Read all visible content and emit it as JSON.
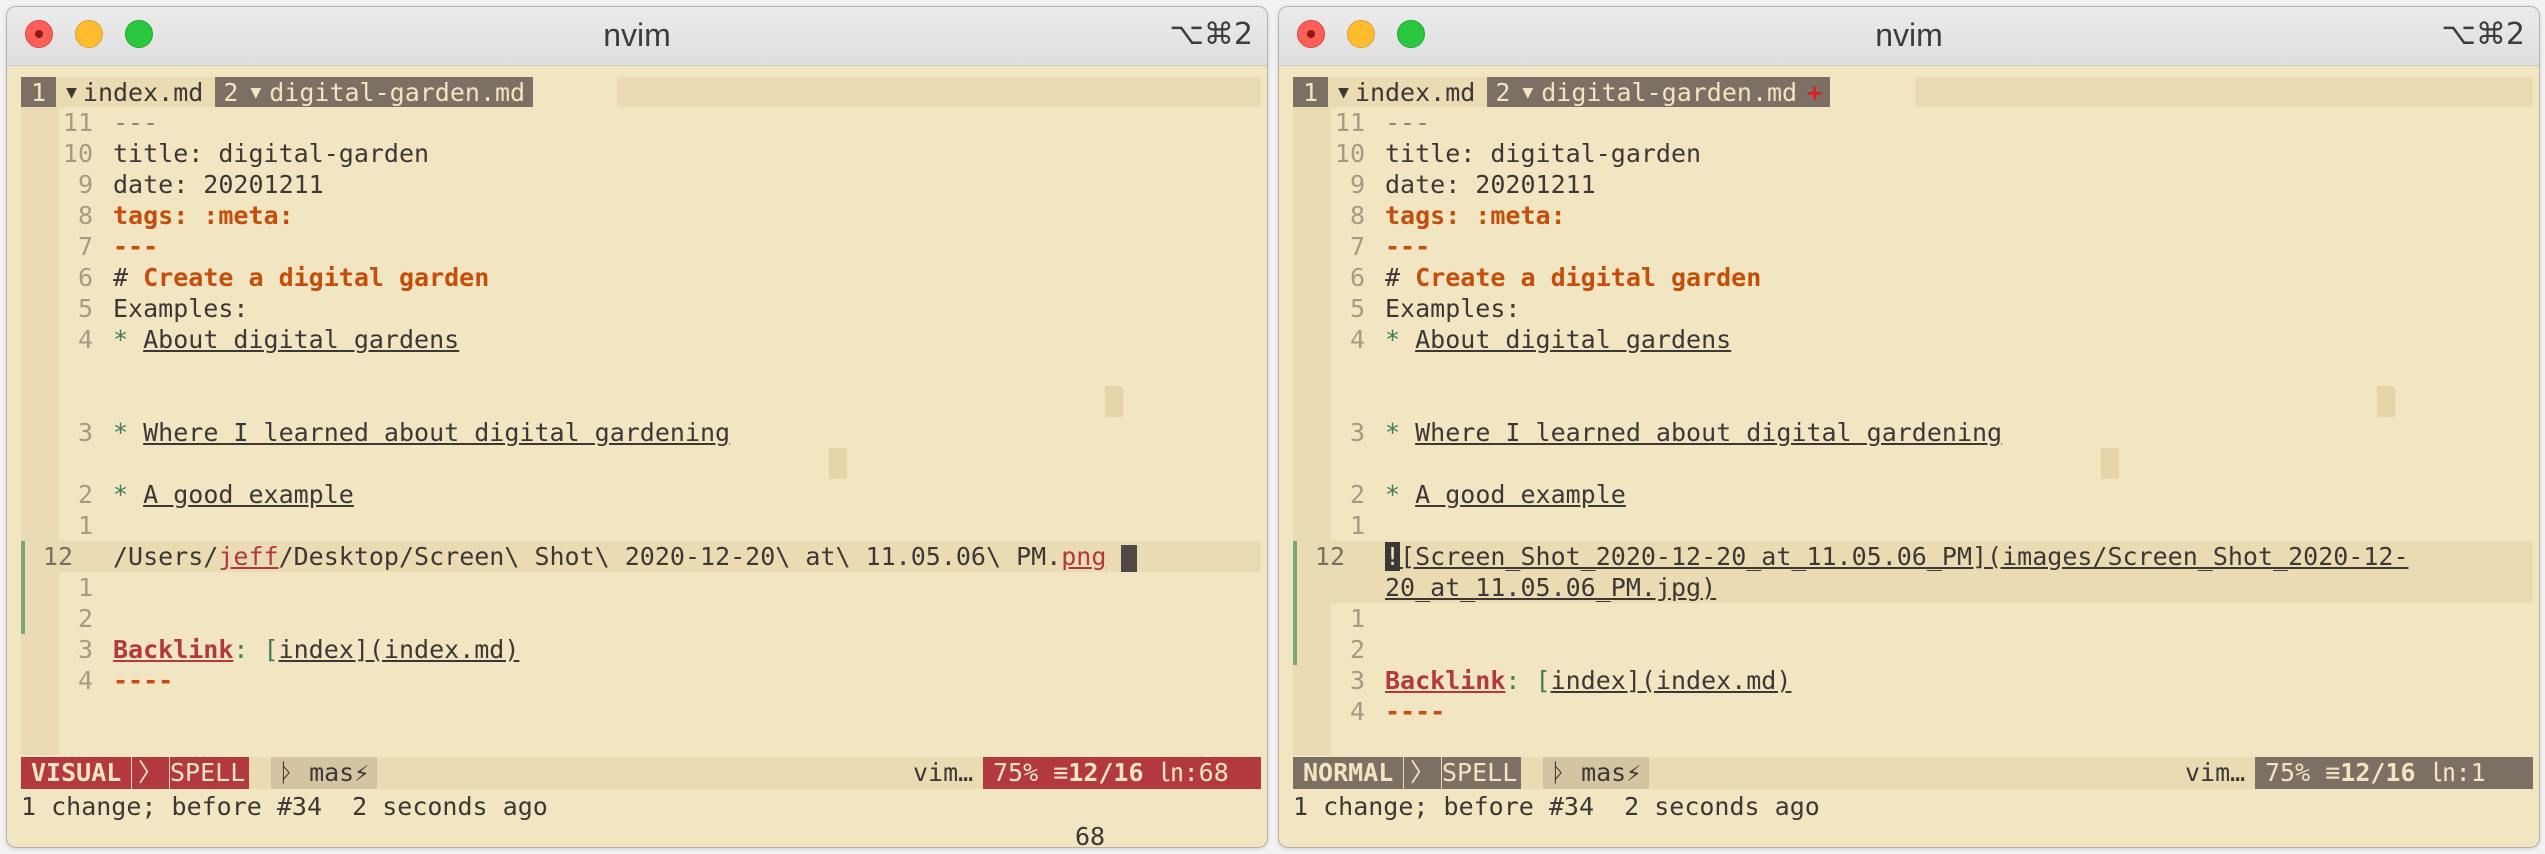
{
  "windows": [
    {
      "title": "nvim",
      "shortcut": "⌥⌘2",
      "tabs": [
        {
          "num": "1",
          "icon": "🡫",
          "name": "index.md",
          "modified": ""
        },
        {
          "num": "2",
          "icon": "🡫",
          "name": "digital-garden.md",
          "modified": ""
        }
      ],
      "lines": {
        "l11": {
          "no": "11",
          "text": "---"
        },
        "l10": {
          "no": "10",
          "text": "title: digital-garden"
        },
        "l9": {
          "no": "9",
          "text": "date: 20201211"
        },
        "l8": {
          "no": "8",
          "text": "tags: :meta:"
        },
        "l7": {
          "no": "7",
          "text": "---"
        },
        "l6": {
          "no": "6",
          "hash": "# ",
          "text": "Create a digital garden"
        },
        "l5": {
          "no": "5",
          "text": "Examples:"
        },
        "l4": {
          "no": "4",
          "bullet": "* ",
          "text": "About digital gardens"
        },
        "l3": {
          "no": "3",
          "bullet": "* ",
          "text": "Where I learned about digital gardening"
        },
        "l2": {
          "no": "2",
          "bullet": "* ",
          "text": "A good example"
        },
        "l1": {
          "no": "1",
          "text": ""
        },
        "cur": {
          "no": "12",
          "p1": "/Users/",
          "p2": "jeff",
          "p3": "/Desktop/Screen\\ Shot\\ 2020-12-20\\ at\\ 11.05.06\\ PM.",
          "p4": "png"
        },
        "a1": {
          "no": "1"
        },
        "a2": {
          "no": "2"
        },
        "a3": {
          "no": "3",
          "key": "Backlink",
          "rest": ": [",
          "linktext": "index](index.md)",
          "close": ""
        },
        "a4": {
          "no": "4",
          "text": "----"
        }
      },
      "status": {
        "mode": "VISUAL",
        "sep": "〉",
        "spell": "SPELL",
        "branch_icon": "ᚦ",
        "branch": "mas⚡",
        "filetype": "vim…",
        "percent": "75%",
        "position_icon": "≡",
        "position": "12/16",
        "col_icon": "㏑",
        "col": ":68"
      },
      "cmdline": "1 change; before #34  2 seconds ago",
      "ruler": "68"
    },
    {
      "title": "nvim",
      "shortcut": "⌥⌘2",
      "tabs": [
        {
          "num": "1",
          "icon": "🡫",
          "name": "index.md",
          "modified": ""
        },
        {
          "num": "2",
          "icon": "🡫",
          "name": "digital-garden.md",
          "modified": "+"
        }
      ],
      "lines": {
        "l11": {
          "no": "11",
          "text": "---"
        },
        "l10": {
          "no": "10",
          "text": "title: digital-garden"
        },
        "l9": {
          "no": "9",
          "text": "date: 20201211"
        },
        "l8": {
          "no": "8",
          "text": "tags: :meta:"
        },
        "l7": {
          "no": "7",
          "text": "---"
        },
        "l6": {
          "no": "6",
          "hash": "# ",
          "text": "Create a digital garden"
        },
        "l5": {
          "no": "5",
          "text": "Examples:"
        },
        "l4": {
          "no": "4",
          "bullet": "* ",
          "text": "About digital gardens"
        },
        "l3": {
          "no": "3",
          "bullet": "* ",
          "text": "Where I learned about digital gardening"
        },
        "l2": {
          "no": "2",
          "bullet": "* ",
          "text": "A good example"
        },
        "l1": {
          "no": "1",
          "text": ""
        },
        "cur": {
          "no": "12",
          "bang": "!",
          "line1": "[Screen_Shot_2020-12-20_at_11.05.06_PM](images/Screen_Shot_2020-12-",
          "line2": "20_at_11.05.06_PM.jpg)"
        },
        "a1": {
          "no": "1"
        },
        "a2": {
          "no": "2"
        },
        "a3": {
          "no": "3",
          "key": "Backlink",
          "rest": ": [",
          "linktext": "index](index.md)",
          "close": ""
        },
        "a4": {
          "no": "4",
          "text": "----"
        }
      },
      "status": {
        "mode": "NORMAL",
        "sep": "〉",
        "spell": "SPELL",
        "branch_icon": "ᚦ",
        "branch": "mas⚡",
        "filetype": "vim…",
        "percent": "75%",
        "position_icon": "≡",
        "position": "12/16",
        "col_icon": "㏑",
        "col": ":1"
      },
      "cmdline": "1 change; before #34  2 seconds ago"
    }
  ]
}
